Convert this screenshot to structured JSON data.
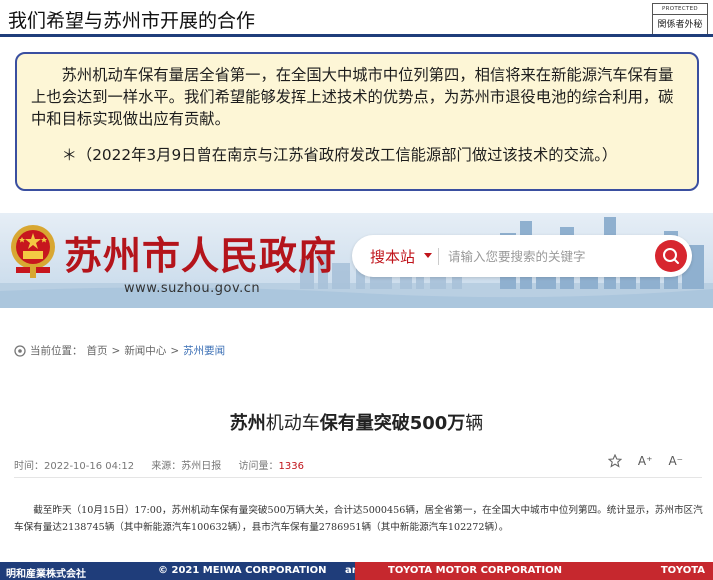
{
  "slide": {
    "title": "我们希望与苏州市开展的合作",
    "stamp_top": "PROTECTED",
    "stamp_bottom": "関係者外秘"
  },
  "callout": {
    "paragraph": "苏州机动车保有量居全省第一，在全国大中城市中位列第四，相信将来在新能源汽车保有量上也会达到一样水平。我们希望能够发挥上述技术的优势点，为苏州市退役电池的综合利用，碳中和目标实现做出应有贡献。",
    "note": "＊（2022年3月9日曾在南京与江苏省政府发改工信能源部门做过该技术的交流。）"
  },
  "website": {
    "name": "苏州市人民政府",
    "url": "www.suzhou.gov.cn",
    "search_type": "搜本站",
    "search_placeholder": "请输入您要搜索的关键字",
    "icons": [
      "national-emblem",
      "search-icon",
      "location-icon",
      "star-icon",
      "font-increase",
      "font-decrease"
    ]
  },
  "breadcrumb": {
    "prefix": "当前位置：",
    "home": "首页",
    "sep1": ">",
    "news": "新闻中心",
    "sep2": ">",
    "current": "苏州要闻"
  },
  "article": {
    "title_parts": [
      "苏州",
      "机动车",
      "保有量",
      "突破500万",
      "辆"
    ],
    "time": "时间：2022-10-16 04:12",
    "source": "来源：苏州日报",
    "views_label": "访问量：",
    "views": "1336",
    "font_increase": "A⁺",
    "font_decrease": "A⁻",
    "body": "截至昨天（10月15日）17:00，苏州机动车保有量突破500万辆大关，合计达5000456辆，居全省第一，在全国大中城市中位列第四。统计显示，苏州市区汽车保有量达2138745辆（其中新能源汽车100632辆），县市汽车保有量2786951辆（其中新能源汽车102272辆）。"
  },
  "footer": {
    "meiwa": "明和産業株式会社",
    "copyright": "© 2021 MEIWA CORPORATION",
    "and": "and",
    "tmc": "TOYOTA MOTOR CORPORATION",
    "toyota": "TOYOTA"
  },
  "colors": {
    "navy": "#1f3d7a",
    "red": "#c6282e",
    "callout_bg": "#fdf6d6",
    "callout_border": "#3a4fa0",
    "gov_red": "#b4141b"
  }
}
